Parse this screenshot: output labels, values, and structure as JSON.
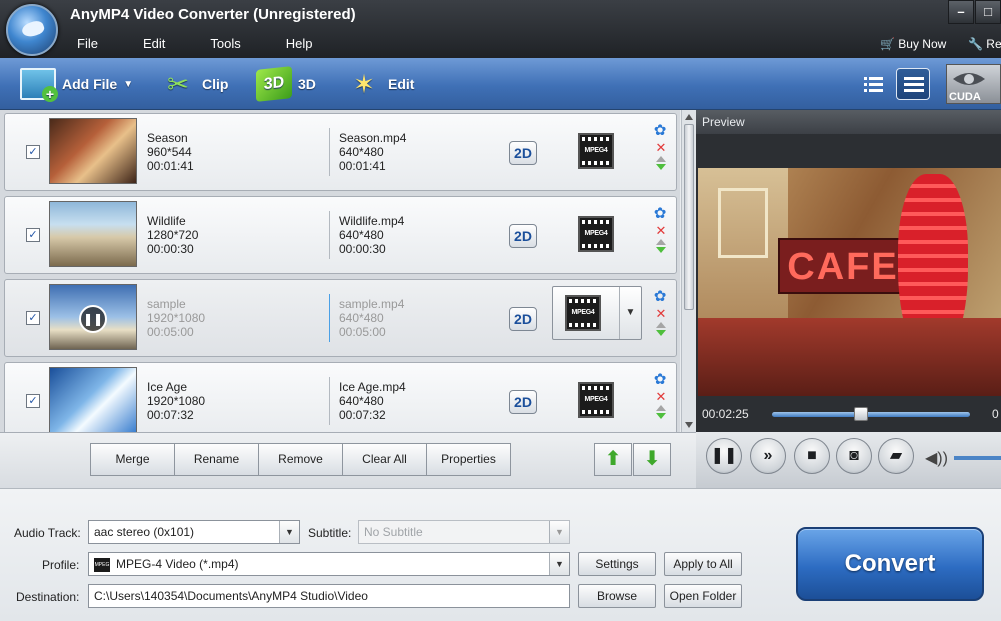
{
  "window": {
    "title": "AnyMP4 Video Converter (Unregistered)",
    "minimize": "–",
    "maximize": "□"
  },
  "menu": [
    "File",
    "Edit",
    "Tools",
    "Help"
  ],
  "topright": {
    "buy_now": "Buy Now",
    "register": "Re"
  },
  "toolbar": {
    "add_file": "Add File",
    "clip": "Clip",
    "three_d": "3D",
    "three_d_badge": "3D",
    "edit": "Edit",
    "cuda": "CUDA"
  },
  "files": [
    {
      "checked": "✓",
      "source_name": "Season",
      "source_res": "960*544",
      "source_dur": "00:01:41",
      "out_name": "Season.mp4",
      "out_res": "640*480",
      "out_dur": "00:01:41",
      "mode": "2D",
      "format_icon": "MPEG4"
    },
    {
      "checked": "✓",
      "source_name": "Wildlife",
      "source_res": "1280*720",
      "source_dur": "00:00:30",
      "out_name": "Wildlife.mp4",
      "out_res": "640*480",
      "out_dur": "00:00:30",
      "mode": "2D",
      "format_icon": "MPEG4"
    },
    {
      "checked": "✓",
      "source_name": "sample",
      "source_res": "1920*1080",
      "source_dur": "00:05:00",
      "out_name": "sample.mp4",
      "out_res": "640*480",
      "out_dur": "00:05:00",
      "mode": "2D",
      "format_icon": "MPEG4"
    },
    {
      "checked": "✓",
      "source_name": "Ice Age",
      "source_res": "1920*1080",
      "source_dur": "00:07:32",
      "out_name": "Ice Age.mp4",
      "out_res": "640*480",
      "out_dur": "00:07:32",
      "mode": "2D",
      "format_icon": "MPEG4"
    }
  ],
  "list_actions": {
    "merge": "Merge",
    "rename": "Rename",
    "remove": "Remove",
    "clear_all": "Clear All",
    "properties": "Properties"
  },
  "preview": {
    "title": "Preview",
    "sign_text": "CAFE",
    "elapsed": "00:02:25",
    "total": "0",
    "seek_fraction": 0.45
  },
  "settings": {
    "audio_track_label": "Audio Track:",
    "audio_track_value": "aac stereo (0x101)",
    "subtitle_label": "Subtitle:",
    "subtitle_placeholder": "No Subtitle",
    "profile_label": "Profile:",
    "profile_value": "MPEG-4 Video (*.mp4)",
    "profile_icon": "MPEG",
    "settings_btn": "Settings",
    "apply_all_btn": "Apply to All",
    "destination_label": "Destination:",
    "destination_value": "C:\\Users\\140354\\Documents\\AnyMP4 Studio\\Video",
    "browse_btn": "Browse",
    "open_folder_btn": "Open Folder",
    "convert_btn": "Convert"
  },
  "colors": {
    "accent": "#3f70b6",
    "convert": "#2d6cc2",
    "remove": "#e23a3a",
    "move": "#4fbf3d"
  }
}
